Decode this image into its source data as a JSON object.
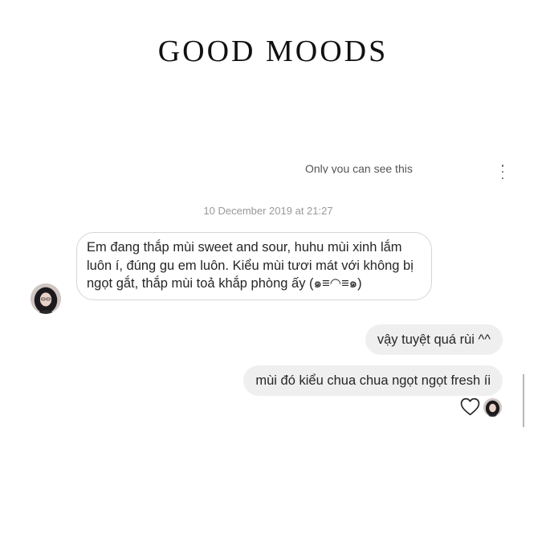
{
  "brand": {
    "title": "GOOD MOODS"
  },
  "thread": {
    "private_note": "Only you can see this",
    "more_icon": "more-vertical-icon",
    "timestamp": "10 December 2019 at 21:27",
    "messages": [
      {
        "direction": "incoming",
        "text": "Em đang thắp mùi sweet and sour, huhu mùi xinh lắm luôn í, đúng gu em luôn. Kiểu mùi tươi mát với không bị ngọt gắt, thắp mùi toả khắp phòng ấy (๑≡◠≡๑)"
      },
      {
        "direction": "outgoing",
        "text": "vậy tuyệt quá rùi ^^"
      },
      {
        "direction": "outgoing",
        "text": "mùi đó kiểu chua chua ngọt ngọt fresh íi"
      }
    ],
    "reaction": {
      "icon": "heart-outline-icon"
    }
  },
  "colors": {
    "outgoing_bubble": "#efefef",
    "incoming_border": "#d5d5d5",
    "timestamp_text": "#999999",
    "brand_text": "#111111"
  }
}
